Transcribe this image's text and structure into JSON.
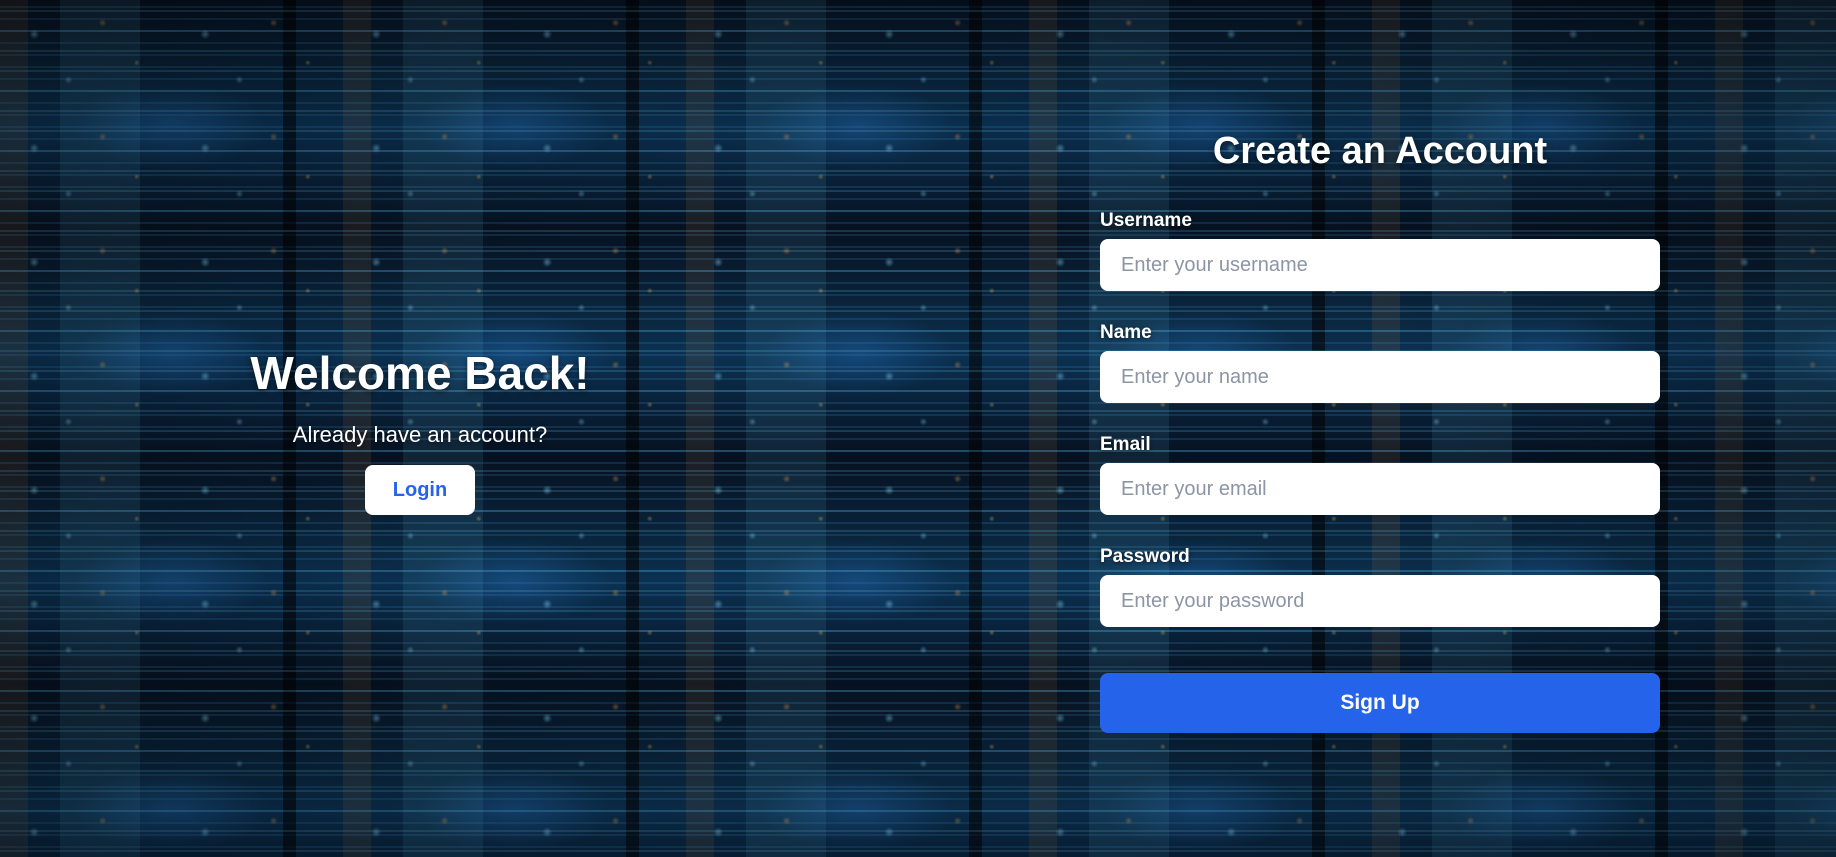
{
  "left": {
    "title": "Welcome Back!",
    "subtitle": "Already have an account?",
    "login_label": "Login"
  },
  "signup_form": {
    "title": "Create an Account",
    "fields": [
      {
        "label": "Username",
        "placeholder": "Enter your username",
        "value": ""
      },
      {
        "label": "Name",
        "placeholder": "Enter your name",
        "value": ""
      },
      {
        "label": "Email",
        "placeholder": "Enter your email",
        "value": ""
      },
      {
        "label": "Password",
        "placeholder": "Enter your password",
        "value": ""
      }
    ],
    "submit_label": "Sign Up"
  },
  "colors": {
    "accent": "#2563eb",
    "input_background": "#ffffff",
    "text": "#ffffff",
    "background": "#071525"
  },
  "background": {
    "image": "code-screen-texture"
  }
}
